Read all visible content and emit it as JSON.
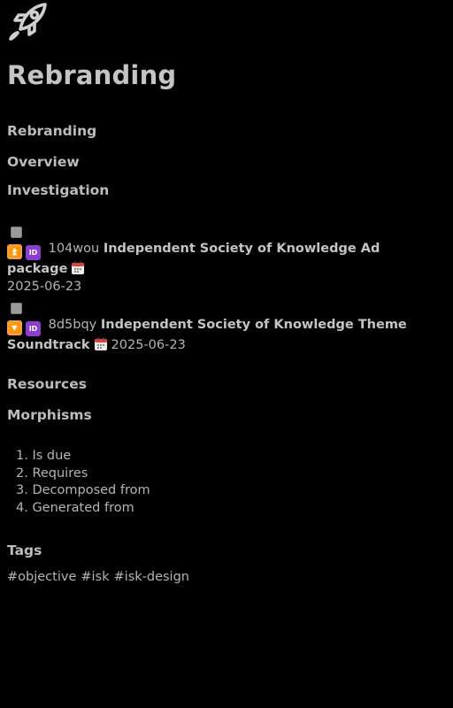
{
  "page": {
    "title": "Rebranding",
    "icon": "rocket-icon"
  },
  "sections": {
    "rebranding": "Rebranding",
    "overview": "Overview",
    "investigation": "Investigation",
    "resources": "Resources",
    "morphisms": "Morphisms",
    "tags": "Tags"
  },
  "tasks": [
    {
      "priority_icon": "highest-priority-icon",
      "priority_glyph": "⏫",
      "id_label": "ID",
      "id": "104wou",
      "title": "Independent Society of Knowledge Ad package",
      "due_icon": "calendar-icon",
      "due": "2025-06-23",
      "checked": false
    },
    {
      "priority_icon": "low-priority-icon",
      "priority_glyph": "🔽",
      "id_label": "ID",
      "id": "8d5bqy",
      "title": "Independent Society of Knowledge Theme Soundtrack",
      "due_icon": "calendar-icon",
      "due": "2025-06-23",
      "checked": false
    }
  ],
  "morphisms": [
    "1. Is due",
    "2. Requires",
    "3. Decomposed from",
    "4. Generated from"
  ],
  "tag_list": [
    "#objective",
    "#isk",
    "#isk-design"
  ],
  "colors": {
    "background": "#000000",
    "text": "#b5b5b5",
    "heading": "#c4c4c4",
    "priority_badge": "#f0a040",
    "id_badge": "#8a3fd0"
  }
}
